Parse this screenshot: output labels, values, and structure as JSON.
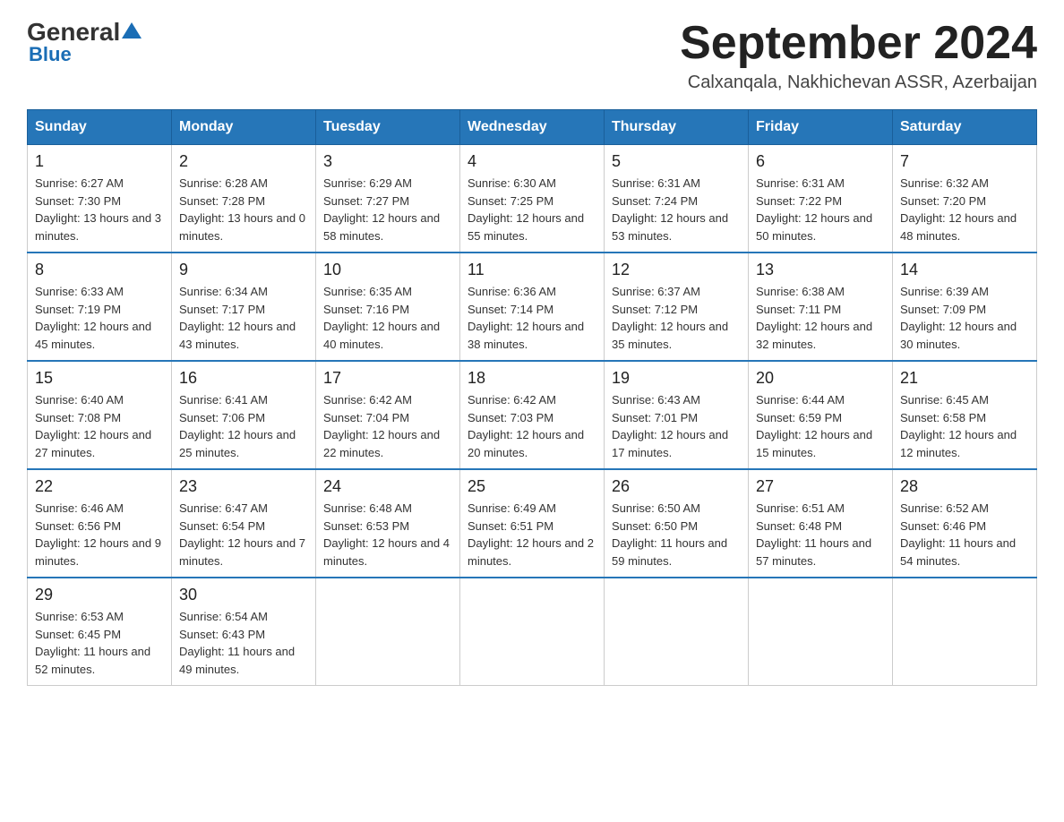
{
  "header": {
    "logo_general": "General",
    "logo_blue": "Blue",
    "month_title": "September 2024",
    "location": "Calxanqala, Nakhichevan ASSR, Azerbaijan"
  },
  "weekdays": [
    "Sunday",
    "Monday",
    "Tuesday",
    "Wednesday",
    "Thursday",
    "Friday",
    "Saturday"
  ],
  "weeks": [
    [
      {
        "day": 1,
        "sunrise": "6:27 AM",
        "sunset": "7:30 PM",
        "daylight": "13 hours and 3 minutes."
      },
      {
        "day": 2,
        "sunrise": "6:28 AM",
        "sunset": "7:28 PM",
        "daylight": "13 hours and 0 minutes."
      },
      {
        "day": 3,
        "sunrise": "6:29 AM",
        "sunset": "7:27 PM",
        "daylight": "12 hours and 58 minutes."
      },
      {
        "day": 4,
        "sunrise": "6:30 AM",
        "sunset": "7:25 PM",
        "daylight": "12 hours and 55 minutes."
      },
      {
        "day": 5,
        "sunrise": "6:31 AM",
        "sunset": "7:24 PM",
        "daylight": "12 hours and 53 minutes."
      },
      {
        "day": 6,
        "sunrise": "6:31 AM",
        "sunset": "7:22 PM",
        "daylight": "12 hours and 50 minutes."
      },
      {
        "day": 7,
        "sunrise": "6:32 AM",
        "sunset": "7:20 PM",
        "daylight": "12 hours and 48 minutes."
      }
    ],
    [
      {
        "day": 8,
        "sunrise": "6:33 AM",
        "sunset": "7:19 PM",
        "daylight": "12 hours and 45 minutes."
      },
      {
        "day": 9,
        "sunrise": "6:34 AM",
        "sunset": "7:17 PM",
        "daylight": "12 hours and 43 minutes."
      },
      {
        "day": 10,
        "sunrise": "6:35 AM",
        "sunset": "7:16 PM",
        "daylight": "12 hours and 40 minutes."
      },
      {
        "day": 11,
        "sunrise": "6:36 AM",
        "sunset": "7:14 PM",
        "daylight": "12 hours and 38 minutes."
      },
      {
        "day": 12,
        "sunrise": "6:37 AM",
        "sunset": "7:12 PM",
        "daylight": "12 hours and 35 minutes."
      },
      {
        "day": 13,
        "sunrise": "6:38 AM",
        "sunset": "7:11 PM",
        "daylight": "12 hours and 32 minutes."
      },
      {
        "day": 14,
        "sunrise": "6:39 AM",
        "sunset": "7:09 PM",
        "daylight": "12 hours and 30 minutes."
      }
    ],
    [
      {
        "day": 15,
        "sunrise": "6:40 AM",
        "sunset": "7:08 PM",
        "daylight": "12 hours and 27 minutes."
      },
      {
        "day": 16,
        "sunrise": "6:41 AM",
        "sunset": "7:06 PM",
        "daylight": "12 hours and 25 minutes."
      },
      {
        "day": 17,
        "sunrise": "6:42 AM",
        "sunset": "7:04 PM",
        "daylight": "12 hours and 22 minutes."
      },
      {
        "day": 18,
        "sunrise": "6:42 AM",
        "sunset": "7:03 PM",
        "daylight": "12 hours and 20 minutes."
      },
      {
        "day": 19,
        "sunrise": "6:43 AM",
        "sunset": "7:01 PM",
        "daylight": "12 hours and 17 minutes."
      },
      {
        "day": 20,
        "sunrise": "6:44 AM",
        "sunset": "6:59 PM",
        "daylight": "12 hours and 15 minutes."
      },
      {
        "day": 21,
        "sunrise": "6:45 AM",
        "sunset": "6:58 PM",
        "daylight": "12 hours and 12 minutes."
      }
    ],
    [
      {
        "day": 22,
        "sunrise": "6:46 AM",
        "sunset": "6:56 PM",
        "daylight": "12 hours and 9 minutes."
      },
      {
        "day": 23,
        "sunrise": "6:47 AM",
        "sunset": "6:54 PM",
        "daylight": "12 hours and 7 minutes."
      },
      {
        "day": 24,
        "sunrise": "6:48 AM",
        "sunset": "6:53 PM",
        "daylight": "12 hours and 4 minutes."
      },
      {
        "day": 25,
        "sunrise": "6:49 AM",
        "sunset": "6:51 PM",
        "daylight": "12 hours and 2 minutes."
      },
      {
        "day": 26,
        "sunrise": "6:50 AM",
        "sunset": "6:50 PM",
        "daylight": "11 hours and 59 minutes."
      },
      {
        "day": 27,
        "sunrise": "6:51 AM",
        "sunset": "6:48 PM",
        "daylight": "11 hours and 57 minutes."
      },
      {
        "day": 28,
        "sunrise": "6:52 AM",
        "sunset": "6:46 PM",
        "daylight": "11 hours and 54 minutes."
      }
    ],
    [
      {
        "day": 29,
        "sunrise": "6:53 AM",
        "sunset": "6:45 PM",
        "daylight": "11 hours and 52 minutes."
      },
      {
        "day": 30,
        "sunrise": "6:54 AM",
        "sunset": "6:43 PM",
        "daylight": "11 hours and 49 minutes."
      },
      null,
      null,
      null,
      null,
      null
    ]
  ]
}
